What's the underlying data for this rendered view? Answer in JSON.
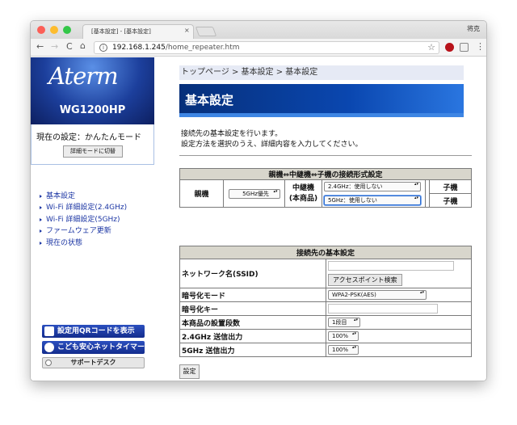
{
  "window": {
    "tab_title": "[基本設定] - [基本設定]",
    "tab_close": "×",
    "profile_name": "将克",
    "traffic": [
      "#fc5f57",
      "#fdbc2e",
      "#33c748"
    ]
  },
  "toolbar": {
    "back": "←",
    "forward": "→",
    "reload": "C",
    "home": "⌂",
    "url_host": "192.168.1.245",
    "url_path": "/home_repeater.htm",
    "star": "☆",
    "menu": "⋮"
  },
  "sidebar": {
    "brand": "Aterm",
    "model": "WG1200HP",
    "mode_label": "現在の設定：かんたんモード",
    "mode_button": "詳細モードに切替",
    "menu": [
      {
        "label": "基本設定"
      },
      {
        "label": "Wi-Fi 詳細設定(2.4GHz)"
      },
      {
        "label": "Wi-Fi 詳細設定(5GHz)"
      },
      {
        "label": "ファームウェア更新"
      },
      {
        "label": "現在の状態"
      }
    ],
    "qr_button": "設定用QRコードを表示",
    "timer_button": "こども安心ネットタイマー",
    "support_button": "サポートデスク"
  },
  "main": {
    "breadcrumb": "トップページ > 基本設定 > 基本設定",
    "title": "基本設定",
    "desc1": "接続先の基本設定を行います。",
    "desc2": "設定方法を選択のうえ、詳細内容を入力してください。",
    "conn_table": {
      "header": "親機⇔中継機⇔子機の接続形式設定",
      "parent": "親機",
      "parent_select": "5GHz優先",
      "repeater1": "中継機",
      "repeater2": "(本商品)",
      "sel_24": "2.4GHz：使用しない",
      "sel_5": "5GHz：使用しない",
      "child1": "子機",
      "child2": "子機"
    },
    "basic_table": {
      "header": "接続先の基本設定",
      "ssid_label": "ネットワーク名(SSID)",
      "ssid_value": "",
      "ap_search": "アクセスポイント検索",
      "enc_mode_label": "暗号化モード",
      "enc_mode_value": "WPA2-PSK(AES)",
      "enc_key_label": "暗号化キー",
      "enc_key_value": "",
      "stage_label": "本商品の設置段数",
      "stage_value": "1段目",
      "out24_label": "2.4GHz 送信出力",
      "out24_value": "100%",
      "out5_label": "5GHz 送信出力",
      "out5_value": "100%"
    },
    "submit": "設定"
  }
}
